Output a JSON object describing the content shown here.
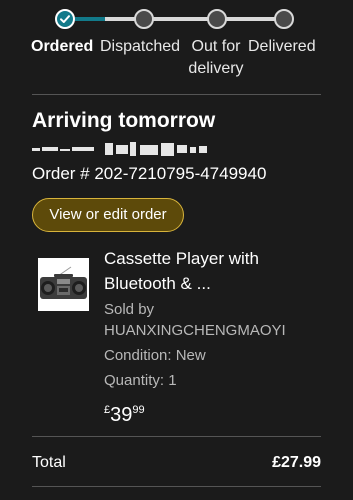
{
  "tracker": {
    "steps": [
      {
        "label": "Ordered",
        "status": "complete"
      },
      {
        "label": "Dispatched",
        "status": "pending"
      },
      {
        "label": "Out for delivery",
        "status": "pending"
      },
      {
        "label": "Delivered",
        "status": "pending"
      }
    ],
    "active_color": "#127a8a",
    "pending_color": "#d9d9d9"
  },
  "order": {
    "heading": "Arriving tomorrow",
    "recipient": "",
    "order_number": "Order # 202-7210795-4749940",
    "view_button_label": "View or edit order",
    "button_color": "#5d4a0a",
    "button_border_color": "#d8b43b"
  },
  "product": {
    "image_icon": "cassette-player-icon",
    "title": "Cassette Player with Bluetooth & ...",
    "sold_by_label": "Sold by",
    "seller": "HUANXINGCHENGMAOYI",
    "condition": "Condition: New",
    "quantity": "Quantity: 1",
    "price_symbol": "£",
    "price_pounds": "39",
    "price_pence": "99"
  },
  "summary": {
    "total_label": "Total",
    "total_value": "£27.99"
  }
}
